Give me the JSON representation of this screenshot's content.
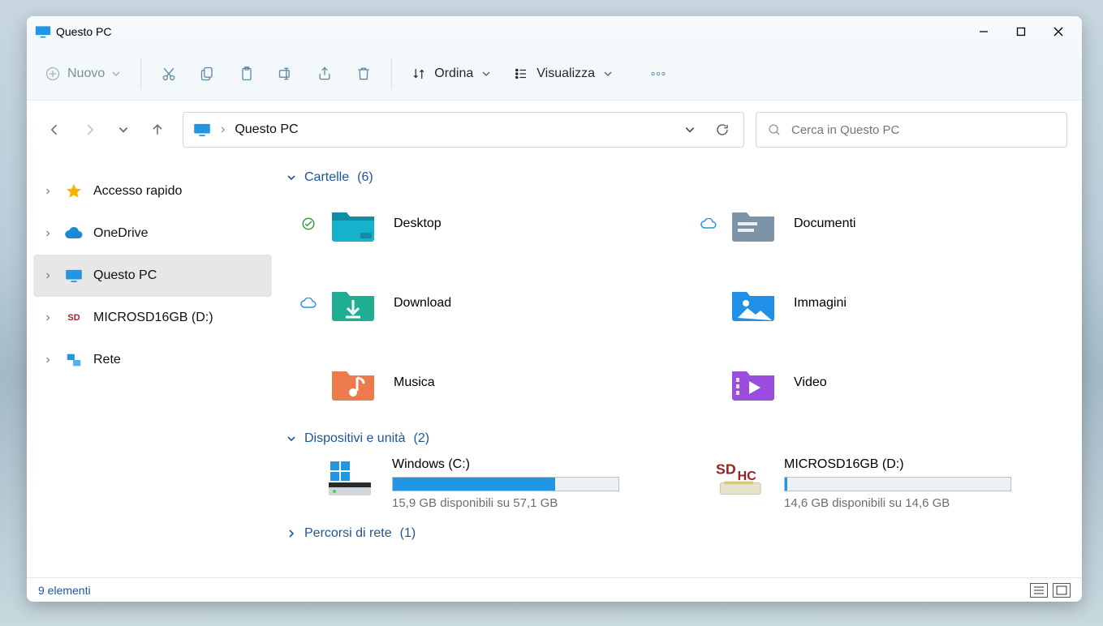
{
  "window": {
    "title": "Questo PC"
  },
  "toolbar": {
    "new_label": "Nuovo",
    "sort_label": "Ordina",
    "view_label": "Visualizza"
  },
  "address": {
    "location": "Questo PC"
  },
  "search": {
    "placeholder": "Cerca in Questo PC"
  },
  "sidebar": {
    "items": [
      {
        "label": "Accesso rapido",
        "icon": "star"
      },
      {
        "label": "OneDrive",
        "icon": "cloud"
      },
      {
        "label": "Questo PC",
        "icon": "monitor",
        "selected": true
      },
      {
        "label": "MICROSD16GB (D:)",
        "icon": "sd"
      },
      {
        "label": "Rete",
        "icon": "network"
      }
    ]
  },
  "groups": {
    "folders": {
      "label": "Cartelle",
      "count": "(6)"
    },
    "drives": {
      "label": "Dispositivi e unità",
      "count": "(2)"
    },
    "network": {
      "label": "Percorsi di rete",
      "count": "(1)"
    }
  },
  "folders": [
    {
      "label": "Desktop",
      "status": "synced"
    },
    {
      "label": "Documenti",
      "status": "cloud"
    },
    {
      "label": "Download",
      "status": "cloud"
    },
    {
      "label": "Immagini",
      "status": ""
    },
    {
      "label": "Musica",
      "status": ""
    },
    {
      "label": "Video",
      "status": ""
    }
  ],
  "drives": [
    {
      "label": "Windows (C:)",
      "avail": "15,9 GB disponibili su 57,1 GB",
      "fill_pct": 72
    },
    {
      "label": "MICROSD16GB (D:)",
      "avail": "14,6 GB disponibili su 14,6 GB",
      "fill_pct": 1
    }
  ],
  "status": {
    "count_label": "9 elementi"
  }
}
